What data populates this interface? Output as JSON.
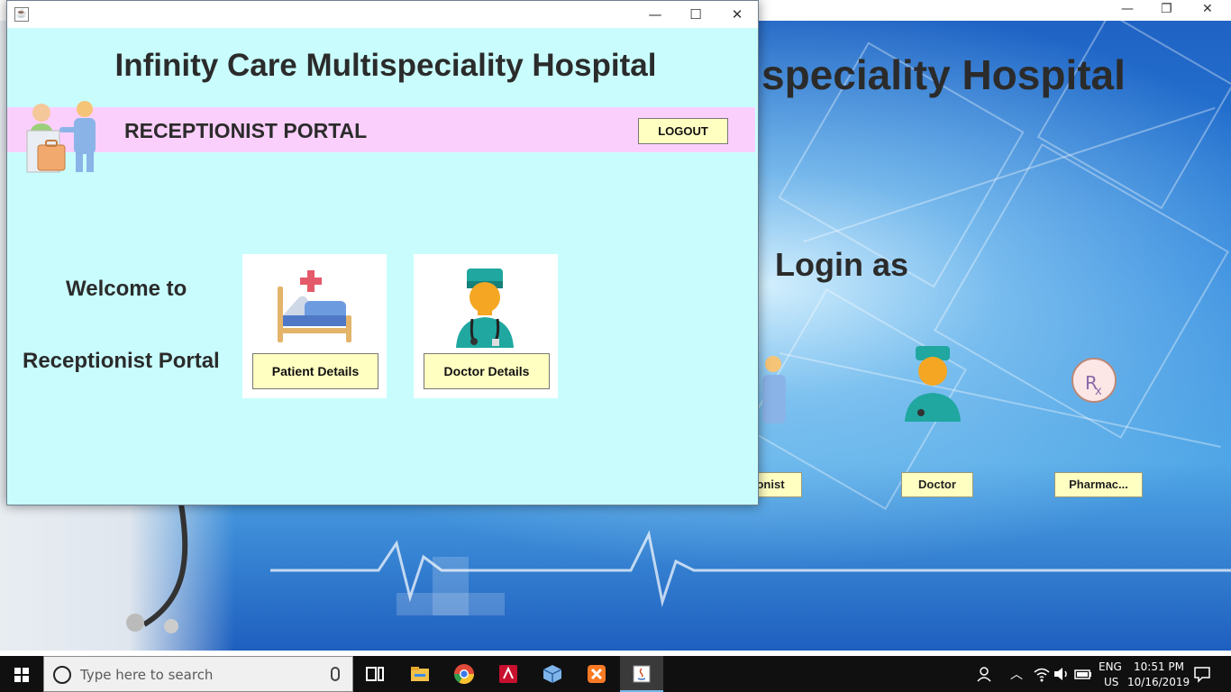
{
  "background_window": {
    "title_partial": "speciality Hospital",
    "login_heading": "Login as",
    "buttons": [
      {
        "label": "onist"
      },
      {
        "label": "Doctor"
      },
      {
        "label": "Pharmac..."
      }
    ]
  },
  "front_window": {
    "hospital_title": "Infinity Care Multispeciality Hospital",
    "portal_label": "RECEPTIONIST PORTAL",
    "logout_label": "LOGOUT",
    "welcome_line1": "Welcome to",
    "welcome_line2": "Receptionist Portal",
    "cards": [
      {
        "label": "Patient Details",
        "icon": "hospital-bed-icon"
      },
      {
        "label": "Doctor Details",
        "icon": "doctor-icon"
      }
    ]
  },
  "taskbar": {
    "search_placeholder": "Type here to search",
    "language_line1": "ENG",
    "language_line2": "US",
    "time": "10:51 PM",
    "date": "10/16/2019",
    "apps": [
      "task-view-icon",
      "file-explorer-icon",
      "chrome-icon",
      "acrobat-icon",
      "virtualbox-icon",
      "xampp-icon",
      "java-icon"
    ]
  },
  "colors": {
    "window_bg": "#c9fdfd",
    "portal_bar": "#fbcffc",
    "button_bg": "#ffffc2",
    "taskbar_bg": "#101010"
  }
}
